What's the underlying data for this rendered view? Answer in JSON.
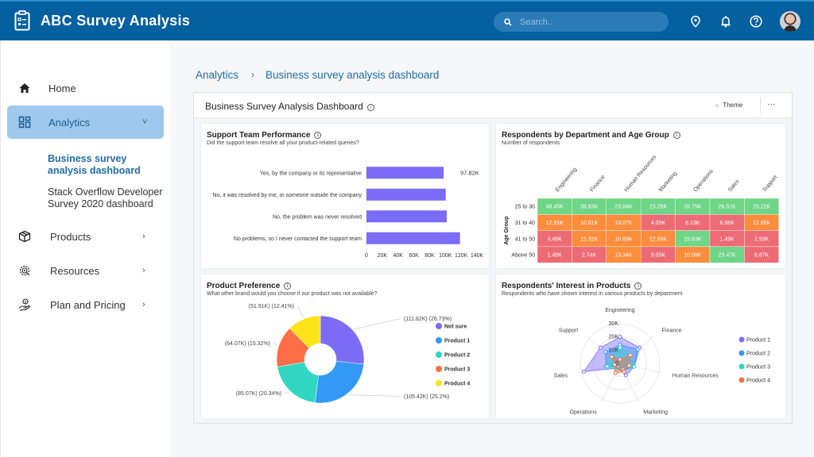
{
  "app": {
    "title": "ABC Survey Analysis",
    "logo_icon": "clipboard-list-icon"
  },
  "header": {
    "search_placeholder": "Search..",
    "icons": [
      "location-pin-icon",
      "bell-icon",
      "help-icon",
      "user-avatar"
    ]
  },
  "sidebar": {
    "items": [
      {
        "label": "Home",
        "icon": "home-icon"
      },
      {
        "label": "Analytics",
        "icon": "dashboard-icon",
        "chevron": "˅",
        "active": true
      },
      {
        "label": "Products",
        "icon": "box-icon",
        "chevron": "›"
      },
      {
        "label": "Resources",
        "icon": "gear-icon",
        "chevron": "›"
      },
      {
        "label": "Plan and Pricing",
        "icon": "hand-coin-icon",
        "chevron": "›"
      }
    ],
    "sub_items": [
      {
        "label": "Business survey analysis dashboard",
        "current": true
      },
      {
        "label": "Stack Overflow Developer Survey 2020 dashboard"
      }
    ]
  },
  "breadcrumb": {
    "root": "Analytics",
    "separator": "›",
    "current": "Business survey analysis dashboard"
  },
  "dashboard": {
    "title": "Business Survey Analysis Dashboard",
    "theme_label": "Theme",
    "more_label": "···"
  },
  "cards": {
    "support": {
      "title": "Support Team Performance",
      "subtitle": "Did the support team resolve all your product-related queries?"
    },
    "heatmap": {
      "title": "Respondents by Department and Age Group",
      "subtitle": "Number of respondents"
    },
    "pie": {
      "title": "Product Preference",
      "subtitle": "What other brand would you choose if our product was not available?"
    },
    "radar": {
      "title": "Respondents' Interest in Products",
      "subtitle": "Respondents who have shown interest in various products by department"
    }
  },
  "chart_data": [
    {
      "type": "bar",
      "orientation": "horizontal",
      "title": "Support Team Performance",
      "categories": [
        "Yes, by the company or its representative",
        "No, it was resolved by me, or someone outside the company",
        "No, the problem was never resolved",
        "No problems, so I never contacted the support team"
      ],
      "values": [
        97.82,
        100.5,
        101.8,
        118.5
      ],
      "value_unit": "K",
      "data_labels": [
        "97.82K",
        null,
        null,
        null
      ],
      "xlim": [
        0,
        140
      ],
      "xticks": [
        "0",
        "20K",
        "40K",
        "60K",
        "80K",
        "100K",
        "120K",
        "140K"
      ],
      "color": "#7b6cf6"
    },
    {
      "type": "heatmap",
      "title": "Respondents by Department and Age Group",
      "subtitle": "Number of respondents",
      "x": [
        "Engineering",
        "Finance",
        "Human Resources",
        "Marketing",
        "Operations",
        "Sales",
        "Support"
      ],
      "y": [
        "25 to 30",
        "31 to 40",
        "41 to 50",
        "Above 50"
      ],
      "ylabel": "Age Group",
      "values": [
        [
          "48.45K",
          "39.83K",
          "23.84K",
          "23.26K",
          "26.75K",
          "26.51K",
          "29.22K"
        ],
        [
          "12.91K",
          "10.01K",
          "13.07K",
          "4.05K",
          "6.13K",
          "6.96K",
          "12.89K"
        ],
        [
          "4.48K",
          "15.32K",
          "10.89K",
          "12.66K",
          "19.63K",
          "1.49K",
          "2.93K"
        ],
        [
          "1.48K",
          "2.74K",
          "13.34K",
          "9.05K",
          "10.09K",
          "23.47K",
          "6.87K"
        ]
      ],
      "color_scale": {
        "low": "#ec6b75",
        "mid": "#fb8d3c",
        "high": "#6fd587"
      }
    },
    {
      "type": "pie",
      "variant": "donut",
      "title": "Product Preference",
      "labels": [
        "Not sure",
        "Product 1",
        "Product 2",
        "Product 3",
        "Product 4"
      ],
      "values": [
        111.82,
        105.42,
        85.07,
        64.07,
        51.91
      ],
      "percents": [
        26.73,
        25.2,
        20.34,
        15.32,
        12.41
      ],
      "data_labels": [
        "(111.82K) (26.73%)",
        "(105.42K) (25.2%)",
        "(85.07K) (20.34%)",
        "(64.07K) (15.32%)",
        "(51.91K) (12.41%)"
      ],
      "colors": [
        "#7c6cf5",
        "#3399f6",
        "#31d6c1",
        "#fd6e47",
        "#fde31a"
      ],
      "legend": "right"
    },
    {
      "type": "radar",
      "title": "Respondents' Interest in Products",
      "axes": [
        "Engineering",
        "Finance",
        "Human Resources",
        "Marketing",
        "Operations",
        "Sales",
        "Support"
      ],
      "rticks": [
        "0",
        "10K",
        "20K",
        "30K"
      ],
      "rlim": [
        0,
        30
      ],
      "series": [
        {
          "name": "Product 1",
          "color": "#7c6cf5",
          "values": [
            20,
            19,
            11,
            10,
            4,
            28,
            19
          ]
        },
        {
          "name": "Product 2",
          "color": "#3399f6",
          "values": [
            14,
            17,
            11,
            6,
            3,
            11,
            14
          ]
        },
        {
          "name": "Product 3",
          "color": "#31d6c1",
          "values": [
            12,
            9,
            11,
            5,
            6,
            10,
            8
          ]
        },
        {
          "name": "Product 4",
          "color": "#fd6e47",
          "values": [
            3,
            10,
            7,
            7,
            8,
            4,
            8
          ]
        }
      ],
      "legend": "right"
    }
  ]
}
